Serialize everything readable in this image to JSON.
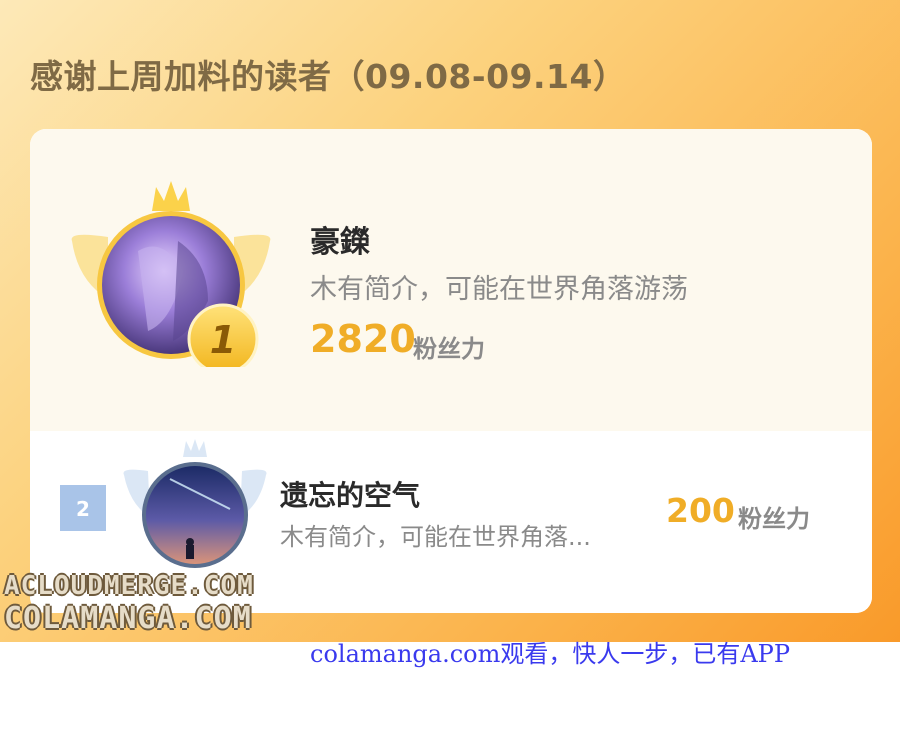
{
  "header": {
    "title": "感谢上周加料的读者（09.08-09.14）"
  },
  "readers": [
    {
      "rank": "1",
      "name": "豪鑅",
      "bio": "木有简介，可能在世界角落游荡",
      "score": "2820",
      "unit": "粉丝力"
    },
    {
      "rank": "2",
      "name": "遗忘的空气",
      "bio": "木有简介，可能在世界角落...",
      "score": "200",
      "unit": "粉丝力"
    }
  ],
  "watermark": {
    "line1": "ACLOUDMERGE.COM",
    "line2": "COLAMANGA.COM"
  },
  "footer": {
    "text": "colamanga.com观看，快人一步，已有APP"
  },
  "colors": {
    "accent": "#f0ad27",
    "banner": "#fbb24a",
    "footer_link": "#3a3aee"
  },
  "icons": [
    "crown-icon",
    "wings-icon",
    "rank-1-medal-icon",
    "rank-2-badge-icon"
  ]
}
